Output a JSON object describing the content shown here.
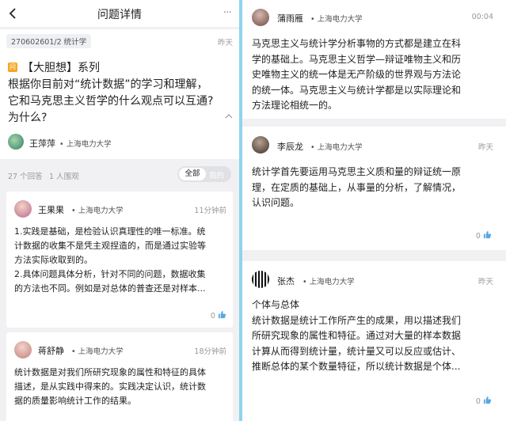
{
  "header": {
    "title": "问题详情",
    "more": "···"
  },
  "question": {
    "tag": "270602601/2 统计学",
    "posted": "昨天",
    "badge": "问",
    "line1": "【大胆想】系列",
    "line2": "根据你目前对“统计数据”的学习和理解，",
    "line3": "它和马克思主义哲学的什么观点可以互通?",
    "line4": "为什么?",
    "author": "王萍萍",
    "school": "• 上海电力大学"
  },
  "stats": {
    "answers": "27 个回答",
    "views": "1 人围观",
    "filter_all": "全部",
    "filter_mine": "我的"
  },
  "answers_left": [
    {
      "name": "王果果",
      "school": "• 上海电力大学",
      "time": "11分钟前",
      "lines": [
        "1.实践是基础，是检验认识真理性的唯一标准。统",
        "计数据的收集不是凭主观捏造的，而是通过实验等",
        "方法实际收取到的。",
        "2.具体问题具体分析，针对不同的问题，数据收集",
        "的方法也不同。例如是对总体的普查还是对样本..."
      ],
      "likes": "0"
    },
    {
      "name": "蒋舒静",
      "school": "• 上海电力大学",
      "time": "18分钟前",
      "lines": [
        "统计数据是对我们所研究现象的属性和特征的具体",
        "描述，是从实践中得来的。实践决定认识，统计数",
        "据的质量影响统计工作的结果。"
      ]
    }
  ],
  "answers_right": [
    {
      "name": "蒲雨雁",
      "school": "• 上海电力大学",
      "time": "00:04",
      "lines": [
        "马克思主义与统计学分析事物的方式都是建立在科",
        "学的基础上。马克思主义哲学—辩证唯物主义和历",
        "史唯物主义的统一体是无产阶级的世界观与方法论",
        "的统一体。马克思主义与统计学都是以实际理论和",
        "方法理论相统一的。"
      ]
    },
    {
      "name": "李辰龙",
      "school": "• 上海电力大学",
      "time": "昨天",
      "lines": [
        "统计学首先要运用马克思主义质和量的辩证统一原",
        "理，在定质的基础上，从事量的分析，了解情况，",
        "认识问题。"
      ],
      "likes": "0"
    },
    {
      "name": "张杰",
      "school": "• 上海电力大学",
      "time": "昨天",
      "lines": [
        "个体与总体",
        "统计数据是统计工作所产生的成果，用以描述我们",
        "所研究现象的属性和特征。通过对大量的样本数据",
        "计算从而得到统计量，统计量又可以反应或估计、",
        "推断总体的某个数量特征，所以统计数据是个体..."
      ],
      "likes": "0"
    }
  ],
  "colors": {
    "accent": "#5aa8e0",
    "badge": "#f5a623",
    "background": "#8fd3ef"
  }
}
